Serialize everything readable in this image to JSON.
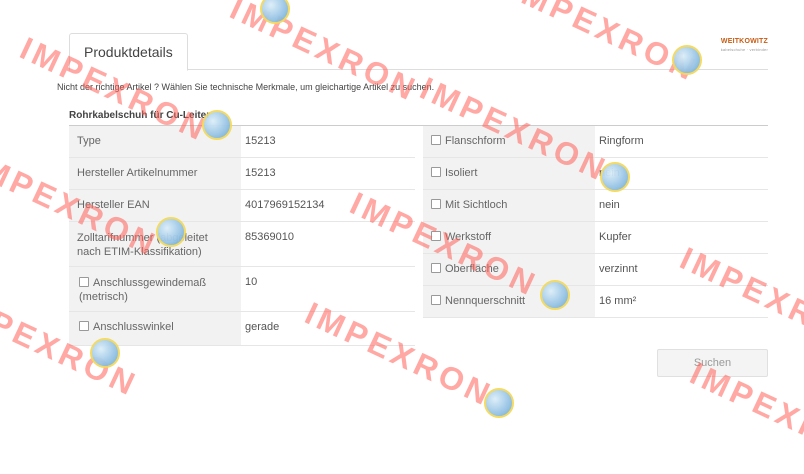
{
  "tab": {
    "label": "Produktdetails"
  },
  "brand": {
    "name": "WEITKOWITZ",
    "tagline": "kabelschuhe · verbinder"
  },
  "hint": "Nicht der richtige Artikel ?   Wählen Sie technische Merkmale, um gleichartige Artikel zu suchen.",
  "section_title": "Rohrkabelschuh für Cu-Leiter",
  "left_rows": [
    {
      "label": "Type",
      "value": "15213",
      "checkbox": false
    },
    {
      "label": "Hersteller Artikelnummer",
      "value": "15213",
      "checkbox": false
    },
    {
      "label": "Hersteller EAN",
      "value": "4017969152134",
      "checkbox": false
    },
    {
      "label": "Zolltarifnummer (abgeleitet nach ETIM-Klassifikation)",
      "value": "85369010",
      "checkbox": false
    },
    {
      "label": "Anschlussgewindemaß (metrisch)",
      "value": "10",
      "checkbox": true
    },
    {
      "label": "Anschlusswinkel",
      "value": "gerade",
      "checkbox": true
    }
  ],
  "right_rows": [
    {
      "label": "Flanschform",
      "value": "Ringform",
      "checkbox": true
    },
    {
      "label": "Isoliert",
      "value": "nein",
      "checkbox": true
    },
    {
      "label": "Mit Sichtloch",
      "value": "nein",
      "checkbox": true
    },
    {
      "label": "Werkstoff",
      "value": "Kupfer",
      "checkbox": true
    },
    {
      "label": "Oberfläche",
      "value": "verzinnt",
      "checkbox": true
    },
    {
      "label": "Nennquerschnitt",
      "value": "16 mm²",
      "checkbox": true
    }
  ],
  "search_button": "Suchen",
  "watermark": {
    "text": "IMPEXRON",
    "color": "#ff605a"
  }
}
